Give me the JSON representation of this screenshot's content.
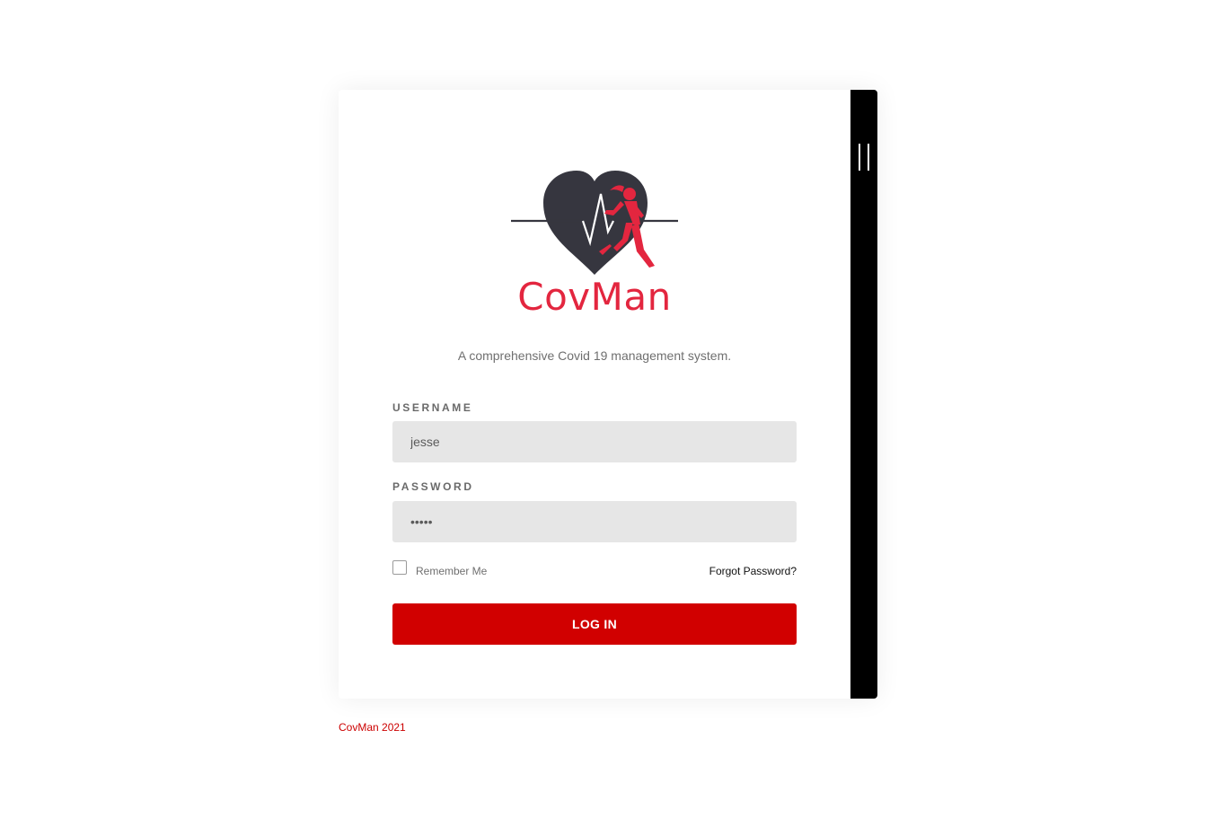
{
  "brand": {
    "name": "CovMan",
    "tagline": "A comprehensive Covid 19 management system.",
    "primary_color": "#d10000",
    "logo_color": "#e3263f",
    "heart_color": "#36363f"
  },
  "form": {
    "username_label": "USERNAME",
    "username_value": "jesse",
    "password_label": "PASSWORD",
    "password_value": "•••••",
    "remember_label": "Remember Me",
    "remember_checked": false,
    "forgot_label": "Forgot Password?",
    "submit_label": "LOG IN"
  },
  "footer": {
    "text": "CovMan 2021"
  },
  "icons": {
    "logo": "heart-runner-icon",
    "side_handle": "panel-handle-icon"
  }
}
